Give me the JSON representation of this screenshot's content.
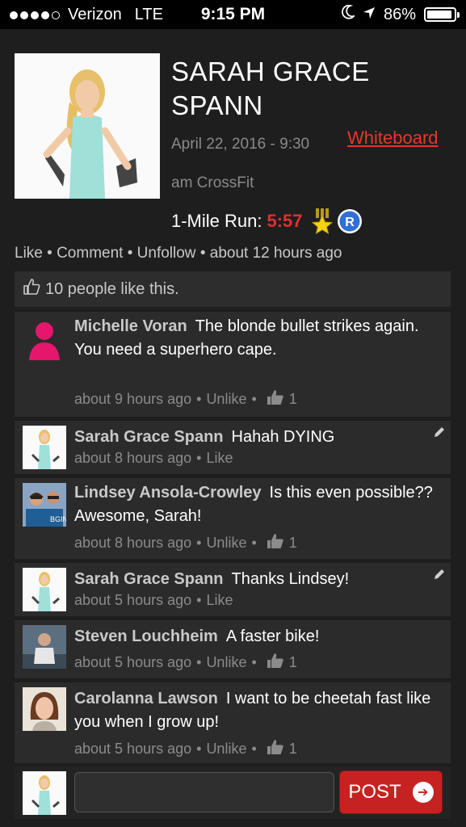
{
  "status_bar": {
    "carrier": "Verizon",
    "network": "LTE",
    "time": "9:15 PM",
    "battery": "86%"
  },
  "post": {
    "author": "SARAH GRACE SPANN",
    "date": "April 22, 2016 - 9:30",
    "gym": "am CrossFit",
    "whiteboard_link": "Whiteboard",
    "workout_label": "1-Mile Run:",
    "result": "5:57",
    "actions": {
      "like": "Like",
      "comment": "Comment",
      "unfollow": "Unfollow",
      "time_ago": "about 12 hours ago",
      "separator": "•"
    },
    "likes_text": "10 people like this."
  },
  "comments": [
    {
      "author": "Michelle Voran",
      "text": "The blonde bullet strikes again. You need a superhero cape.",
      "time": "about 9 hours ago",
      "action": "Unlike",
      "likes": "1",
      "avatar": "placeholder-avatar"
    },
    {
      "author": "Sarah Grace Spann",
      "text": "Hahah DYING",
      "time": "about 8 hours ago",
      "action": "Like",
      "likes": "",
      "avatar": "sarah-avatar"
    },
    {
      "author": "Lindsey Ansola-Crowley",
      "text": "Is this even possible?? Awesome, Sarah!",
      "time": "about 8 hours ago",
      "action": "Unlike",
      "likes": "1",
      "avatar": "lindsey-avatar"
    },
    {
      "author": "Sarah Grace Spann",
      "text": "Thanks Lindsey!",
      "time": "about 5 hours ago",
      "action": "Like",
      "likes": "",
      "avatar": "sarah-avatar"
    },
    {
      "author": "Steven Louchheim",
      "text": "A faster bike!",
      "time": "about 5 hours ago",
      "action": "Unlike",
      "likes": "1",
      "avatar": "steven-avatar"
    },
    {
      "author": "Carolanna Lawson",
      "text": "I want to be cheetah fast like you when I grow up!",
      "time": "about 5 hours ago",
      "action": "Unlike",
      "likes": "1",
      "avatar": "carolanna-avatar"
    }
  ],
  "composer": {
    "input_value": "",
    "post_label": "POST"
  },
  "colors": {
    "accent_red": "#e03030",
    "background": "#1e1e1e",
    "card": "#2b2b2b"
  }
}
